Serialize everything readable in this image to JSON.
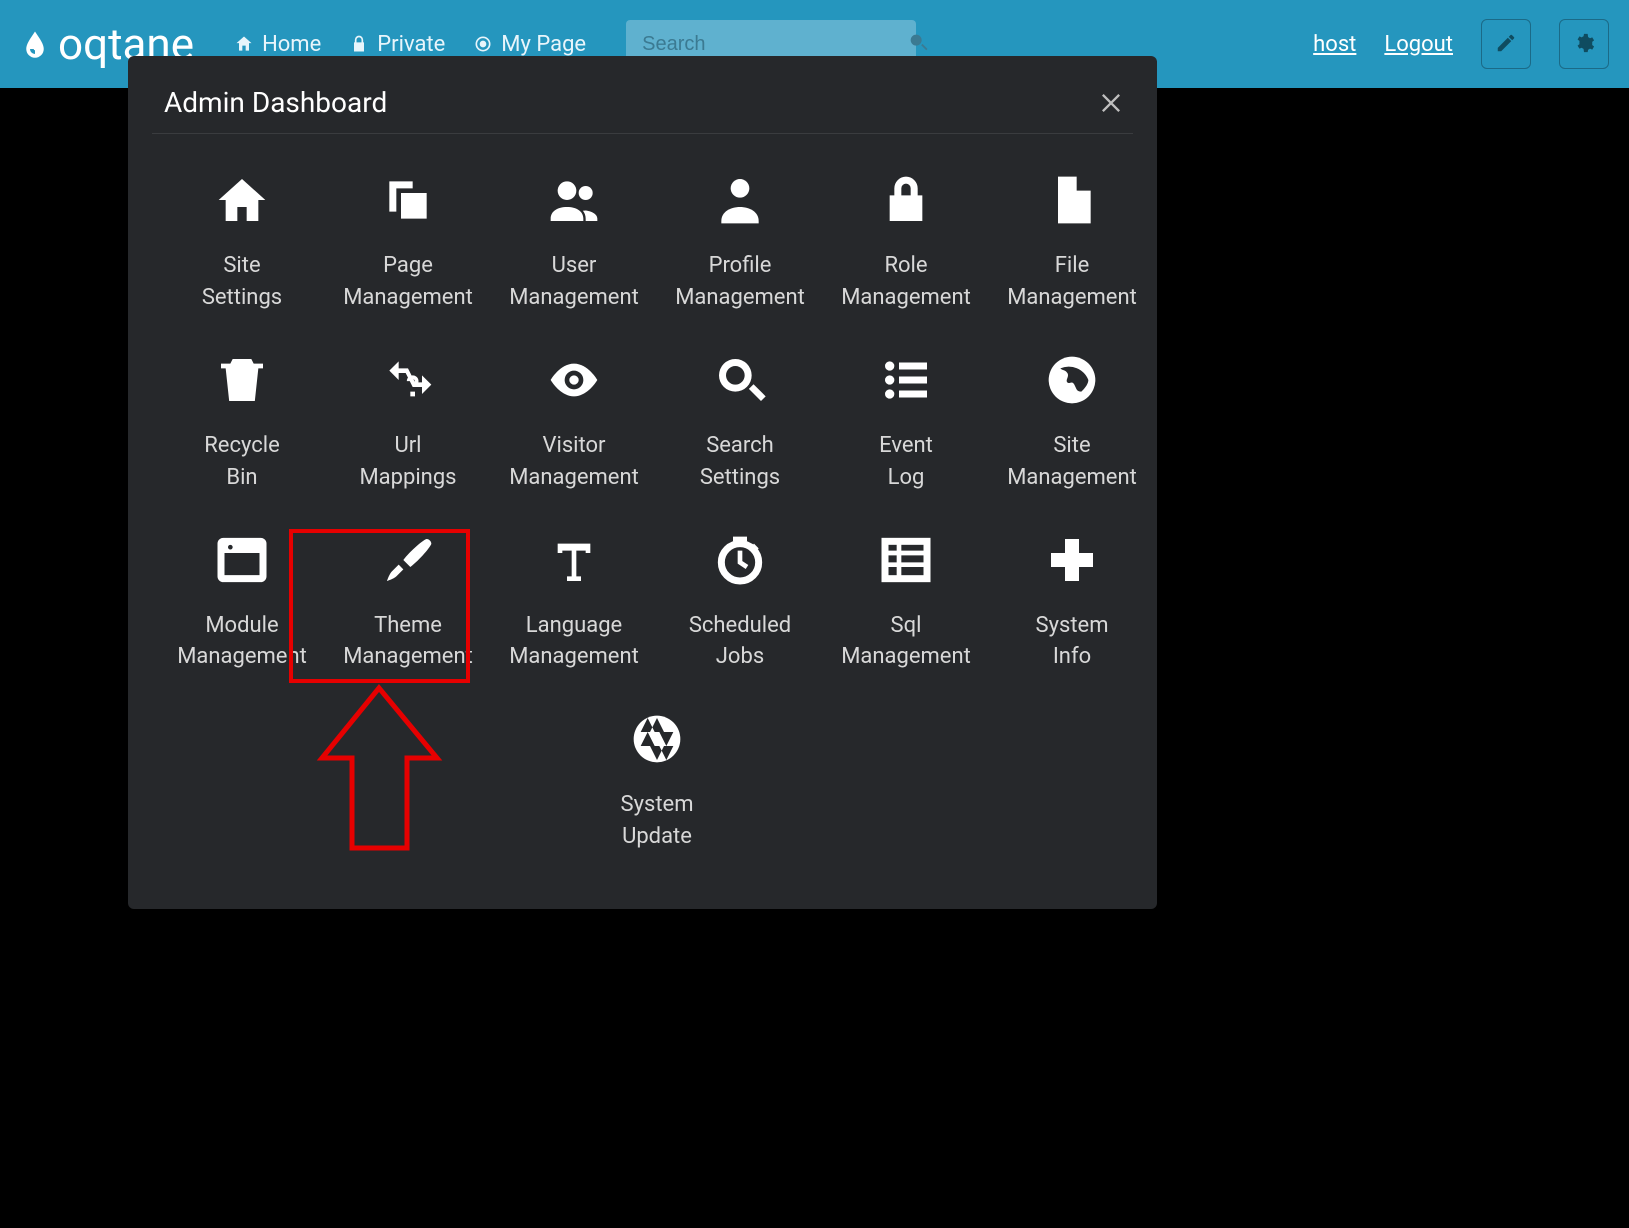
{
  "header": {
    "logo_text": "oqtane",
    "nav": {
      "home": "Home",
      "private": "Private",
      "mypage": "My Page"
    },
    "search_placeholder": "Search",
    "user": "host",
    "logout": "Logout"
  },
  "modal": {
    "title": "Admin Dashboard",
    "items": [
      {
        "id": "site-settings",
        "label": "Site\nSettings",
        "icon": "home"
      },
      {
        "id": "page-management",
        "label": "Page\nManagement",
        "icon": "copy"
      },
      {
        "id": "user-management",
        "label": "User\nManagement",
        "icon": "users"
      },
      {
        "id": "profile-management",
        "label": "Profile\nManagement",
        "icon": "user"
      },
      {
        "id": "role-management",
        "label": "Role\nManagement",
        "icon": "lock"
      },
      {
        "id": "file-management",
        "label": "File\nManagement",
        "icon": "file"
      },
      {
        "id": "recycle-bin",
        "label": "Recycle\nBin",
        "icon": "trash"
      },
      {
        "id": "url-mappings",
        "label": "Url\nMappings",
        "icon": "question-shuffle"
      },
      {
        "id": "visitor-management",
        "label": "Visitor\nManagement",
        "icon": "eye"
      },
      {
        "id": "search-settings",
        "label": "Search\nSettings",
        "icon": "search"
      },
      {
        "id": "event-log",
        "label": "Event\nLog",
        "icon": "list"
      },
      {
        "id": "site-management",
        "label": "Site\nManagement",
        "icon": "globe"
      },
      {
        "id": "module-management",
        "label": "Module\nManagement",
        "icon": "window"
      },
      {
        "id": "theme-management",
        "label": "Theme\nManagement",
        "icon": "brush"
      },
      {
        "id": "language-management",
        "label": "Language\nManagement",
        "icon": "font"
      },
      {
        "id": "scheduled-jobs",
        "label": "Scheduled\nJobs",
        "icon": "timer"
      },
      {
        "id": "sql-management",
        "label": "Sql\nManagement",
        "icon": "table"
      },
      {
        "id": "system-info",
        "label": "System\nInfo",
        "icon": "plus-medical"
      },
      {
        "id": "system-update",
        "label": "System\nUpdate",
        "icon": "aperture"
      }
    ]
  },
  "annotation": {
    "highlighted_item": "theme-management"
  }
}
